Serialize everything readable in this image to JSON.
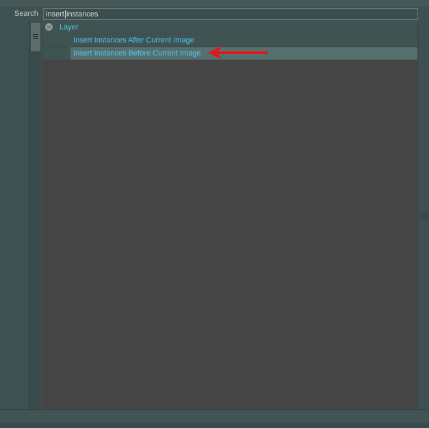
{
  "search": {
    "label": "Search",
    "value": "insert instances"
  },
  "tree": {
    "group": {
      "label": "Layer",
      "expanded": true,
      "items": [
        {
          "label": "Insert Instances After Current Image",
          "selected": false
        },
        {
          "label": "Insert Instances Before Current Image",
          "selected": true
        }
      ]
    }
  },
  "annotation": {
    "icon": "red-arrow-pointing-left",
    "color": "#e01818"
  },
  "colors": {
    "link_text": "#50c8f0",
    "row_background": "#3f5353",
    "selected_row": "#567070",
    "list_background": "#454545",
    "panel_background": "#3e5151"
  }
}
